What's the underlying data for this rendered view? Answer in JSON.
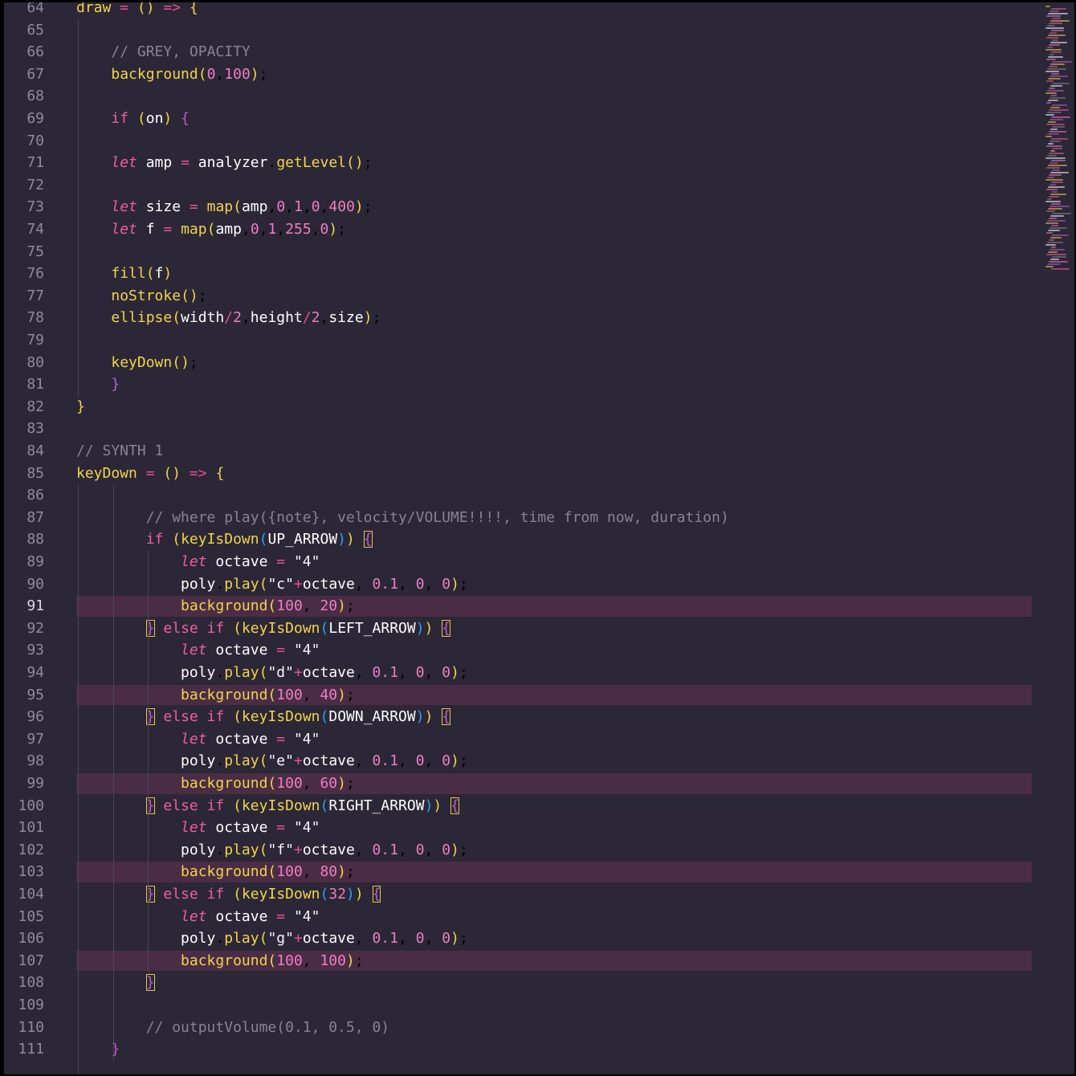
{
  "editor": {
    "current_line": 91,
    "highlighted_lines": [
      91,
      95,
      99,
      103,
      107
    ],
    "lines": [
      {
        "n": "64",
        "code": "draw = () => {"
      },
      {
        "n": "65",
        "code": ""
      },
      {
        "n": "66",
        "code": "    // GREY, OPACITY"
      },
      {
        "n": "67",
        "code": "    background(0,100);"
      },
      {
        "n": "68",
        "code": ""
      },
      {
        "n": "69",
        "code": "    if (on) {"
      },
      {
        "n": "70",
        "code": ""
      },
      {
        "n": "71",
        "code": "    let amp = analyzer.getLevel();"
      },
      {
        "n": "72",
        "code": ""
      },
      {
        "n": "73",
        "code": "    let size = map(amp,0,1,0,400);"
      },
      {
        "n": "74",
        "code": "    let f = map(amp,0,1,255,0);"
      },
      {
        "n": "75",
        "code": ""
      },
      {
        "n": "76",
        "code": "    fill(f)"
      },
      {
        "n": "77",
        "code": "    noStroke();"
      },
      {
        "n": "78",
        "code": "    ellipse(width/2,height/2,size);"
      },
      {
        "n": "79",
        "code": ""
      },
      {
        "n": "80",
        "code": "    keyDown();"
      },
      {
        "n": "81",
        "code": "    }"
      },
      {
        "n": "82",
        "code": "}"
      },
      {
        "n": "83",
        "code": ""
      },
      {
        "n": "84",
        "code": "// SYNTH 1"
      },
      {
        "n": "85",
        "code": "keyDown = () => {"
      },
      {
        "n": "86",
        "code": ""
      },
      {
        "n": "87",
        "code": "        // where play({note}, velocity/VOLUME!!!!, time from now, duration)"
      },
      {
        "n": "88",
        "code": "        if (keyIsDown(UP_ARROW)) {"
      },
      {
        "n": "89",
        "code": "            let octave = \"4\""
      },
      {
        "n": "90",
        "code": "            poly.play(\"c\"+octave, 0.1, 0, 0);"
      },
      {
        "n": "91",
        "code": "            background(100, 20);"
      },
      {
        "n": "92",
        "code": "        } else if (keyIsDown(LEFT_ARROW)) {"
      },
      {
        "n": "93",
        "code": "            let octave = \"4\""
      },
      {
        "n": "94",
        "code": "            poly.play(\"d\"+octave, 0.1, 0, 0);"
      },
      {
        "n": "95",
        "code": "            background(100, 40);"
      },
      {
        "n": "96",
        "code": "        } else if (keyIsDown(DOWN_ARROW)) {"
      },
      {
        "n": "97",
        "code": "            let octave = \"4\""
      },
      {
        "n": "98",
        "code": "            poly.play(\"e\"+octave, 0.1, 0, 0);"
      },
      {
        "n": "99",
        "code": "            background(100, 60);"
      },
      {
        "n": "100",
        "code": "        } else if (keyIsDown(RIGHT_ARROW)) {"
      },
      {
        "n": "101",
        "code": "            let octave = \"4\""
      },
      {
        "n": "102",
        "code": "            poly.play(\"f\"+octave, 0.1, 0, 0);"
      },
      {
        "n": "103",
        "code": "            background(100, 80);"
      },
      {
        "n": "104",
        "code": "        } else if (keyIsDown(32)) {"
      },
      {
        "n": "105",
        "code": "            let octave = \"4\""
      },
      {
        "n": "106",
        "code": "            poly.play(\"g\"+octave, 0.1, 0, 0);"
      },
      {
        "n": "107",
        "code": "            background(100, 100);"
      },
      {
        "n": "108",
        "code": "        }"
      },
      {
        "n": "109",
        "code": ""
      },
      {
        "n": "110",
        "code": "        // outputVolume(0.1, 0.5, 0)"
      },
      {
        "n": "111",
        "code": "    }"
      }
    ]
  }
}
